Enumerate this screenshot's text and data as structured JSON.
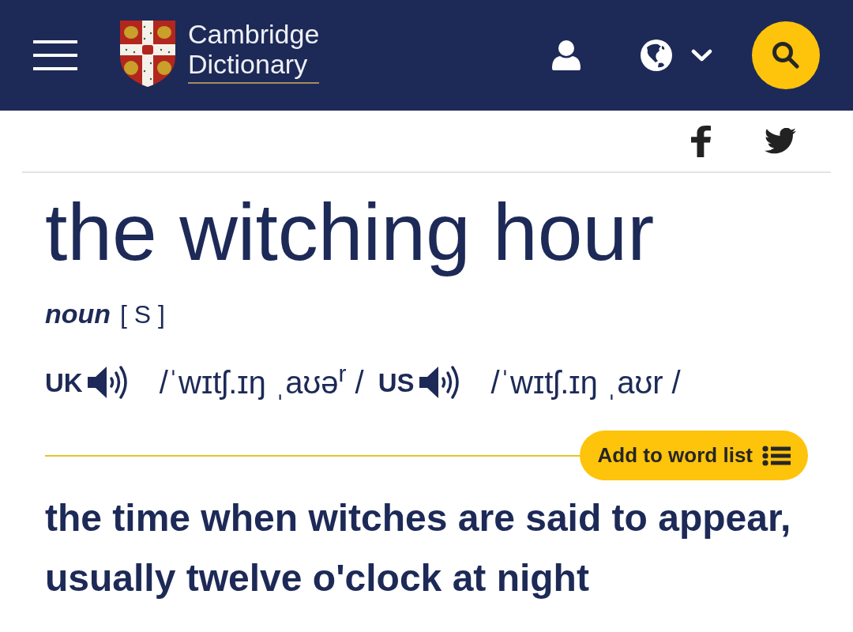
{
  "header": {
    "logo_lines": [
      "Cambridge",
      "Dictionary"
    ]
  },
  "entry": {
    "headword": "the witching hour",
    "part_of_speech": "noun",
    "grammar": "[ S ]",
    "pronunciations": [
      {
        "region": "UK",
        "ipa": "/ˈwɪtʃ.ɪŋ ˌaʊə$^{r}$ /"
      },
      {
        "region": "US",
        "ipa": "/ˈwɪtʃ.ɪŋ ˌaʊr /"
      }
    ],
    "word_list_button": "Add to word list",
    "definition": "the time when witches are said to appear, usually twelve o'clock at night"
  }
}
